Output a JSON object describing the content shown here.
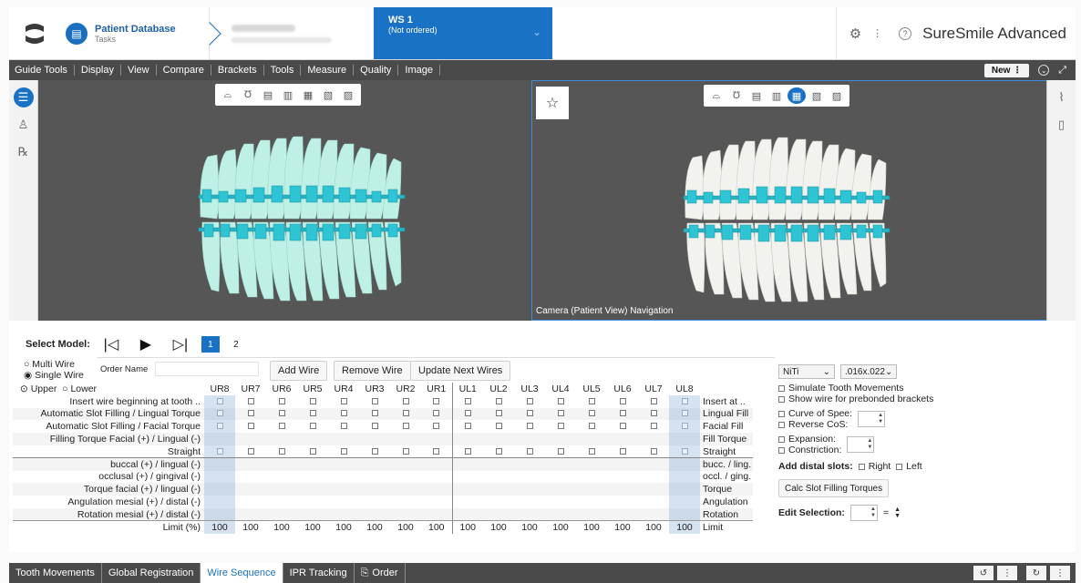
{
  "header": {
    "db_title": "Patient Database",
    "db_sub": "Tasks",
    "ws_title": "WS 1",
    "ws_sub": "(Not ordered)",
    "brand": "SureSmile Advanced"
  },
  "menu": [
    "Guide Tools",
    "Display",
    "View",
    "Compare",
    "Brackets",
    "Tools",
    "Measure",
    "Quality",
    "Image"
  ],
  "menubar_right": {
    "new_label": "New"
  },
  "viewport": {
    "caption": "Camera (Patient View) Navigation"
  },
  "select_model": {
    "label": "Select Model:",
    "pages": [
      "1",
      "2"
    ]
  },
  "wire_mode": {
    "multi": "Multi Wire",
    "single": "Single Wire",
    "order_label": "Order Name"
  },
  "arch": {
    "upper": "Upper",
    "lower": "Lower"
  },
  "buttons": {
    "add": "Add Wire",
    "remove": "Remove Wire",
    "update": "Update Next Wires",
    "calc": "Calc Slot Filling Torques"
  },
  "teeth": [
    "UR8",
    "UR7",
    "UR6",
    "UR5",
    "UR4",
    "UR3",
    "UR2",
    "UR1",
    "UL1",
    "UL2",
    "UL3",
    "UL4",
    "UL5",
    "UL6",
    "UL7",
    "UL8"
  ],
  "rows": [
    {
      "left": "Insert wire beginning at tooth ..",
      "right": "Insert at ..",
      "checks": true
    },
    {
      "left": "Automatic Slot Filling / Lingual Torque",
      "right": "Lingual Fill",
      "checks": true
    },
    {
      "left": "Automatic Slot Filling / Facial Torque",
      "right": "Facial Fill",
      "checks": true
    },
    {
      "left": "Filling Torque Facial (+) / Lingual (-)",
      "right": "Fill Torque",
      "checks": false
    },
    {
      "left": "Straight",
      "right": "Straight",
      "checks": true
    },
    {
      "left": "buccal (+) / lingual (-)",
      "right": "bucc. / ling.",
      "checks": false
    },
    {
      "left": "occlusal (+) / gingival (-)",
      "right": "occl. / ging.",
      "checks": false
    },
    {
      "left": "Torque facial (+) / lingual (-)",
      "right": "Torque",
      "checks": false
    },
    {
      "left": "Angulation mesial (+) / distal (-)",
      "right": "Angulation",
      "checks": false
    },
    {
      "left": "Rotation mesial (+) / distal (-)",
      "right": "Rotation",
      "checks": false
    }
  ],
  "limit": {
    "left": "Limit (%)",
    "right": "Limit",
    "value": "100"
  },
  "right_panel": {
    "material": "NiTi",
    "size": ".016x.022",
    "simulate": "Simulate Tooth Movements",
    "show_wire": "Show wire for prebonded brackets",
    "curve": "Curve of Spee:",
    "reverse": "Reverse CoS:",
    "expansion": "Expansion:",
    "constriction": "Constriction:",
    "distal_label": "Add distal slots:",
    "right": "Right",
    "left": "Left",
    "edit_label": "Edit Selection:",
    "equals": "="
  },
  "tabs": [
    "Tooth Movements",
    "Global Registration",
    "Wire Sequence",
    "IPR Tracking",
    "Order"
  ],
  "active_tab": "Wire Sequence",
  "colors": {
    "accent": "#1a72c6",
    "bracket": "#2fc4d4",
    "teeth_left": "#bff0e6"
  }
}
